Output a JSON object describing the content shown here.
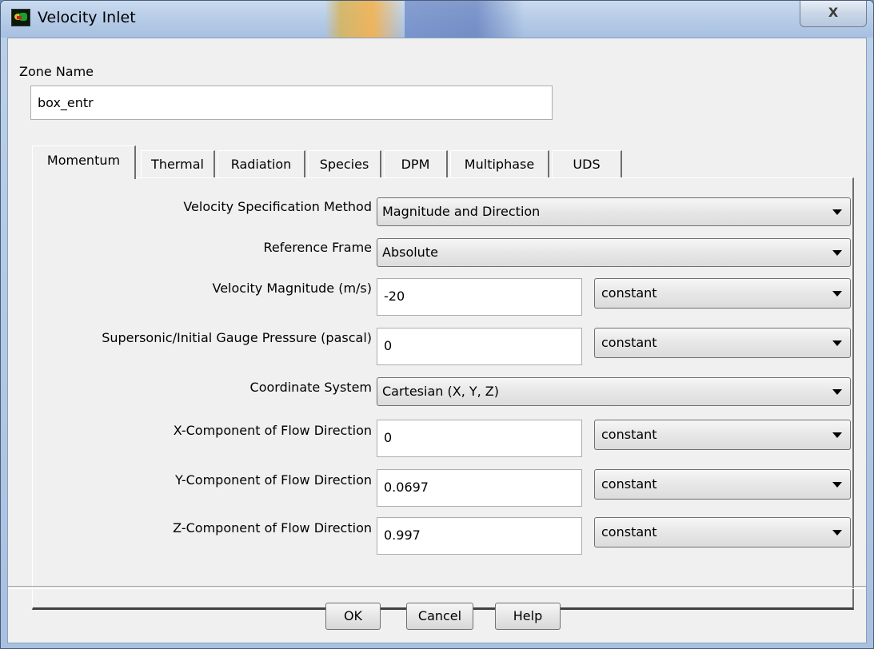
{
  "window": {
    "title": "Velocity Inlet",
    "close_label": "X"
  },
  "zone": {
    "label": "Zone Name",
    "value": "box_entr"
  },
  "tabs": [
    {
      "label": "Momentum",
      "active": true
    },
    {
      "label": "Thermal"
    },
    {
      "label": "Radiation"
    },
    {
      "label": "Species"
    },
    {
      "label": "DPM"
    },
    {
      "label": "Multiphase"
    },
    {
      "label": "UDS"
    }
  ],
  "momentum": {
    "velocity_spec_method": {
      "label": "Velocity Specification Method",
      "value": "Magnitude and Direction"
    },
    "reference_frame": {
      "label": "Reference Frame",
      "value": "Absolute"
    },
    "velocity_magnitude": {
      "label": "Velocity Magnitude (m/s)",
      "value": "-20",
      "profile": "constant"
    },
    "gauge_pressure": {
      "label": "Supersonic/Initial Gauge Pressure (pascal)",
      "value": "0",
      "profile": "constant"
    },
    "coordinate_system": {
      "label": "Coordinate System",
      "value": "Cartesian (X, Y, Z)"
    },
    "x_component": {
      "label": "X-Component of Flow Direction",
      "value": "0",
      "profile": "constant"
    },
    "y_component": {
      "label": "Y-Component of Flow Direction",
      "value": "0.0697",
      "profile": "constant"
    },
    "z_component": {
      "label": "Z-Component of Flow Direction",
      "value": "0.997",
      "profile": "constant"
    }
  },
  "buttons": {
    "ok": "OK",
    "cancel": "Cancel",
    "help": "Help"
  }
}
